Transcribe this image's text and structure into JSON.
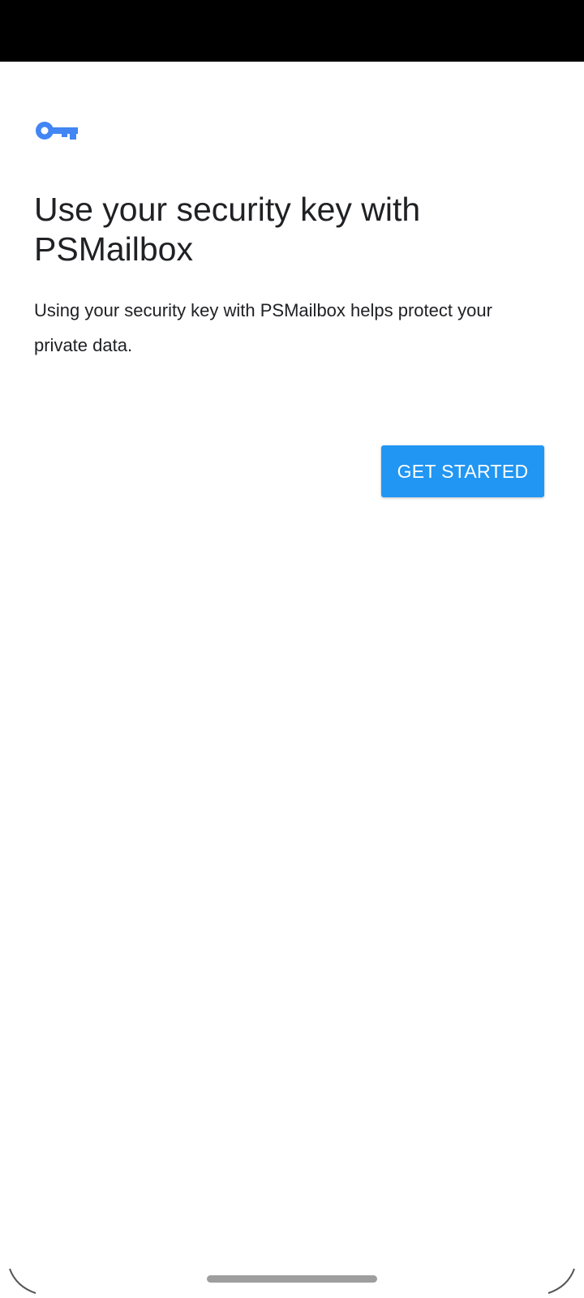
{
  "colors": {
    "accent": "#4285f4",
    "button": "#2196f3",
    "status_bar": "#000000",
    "text": "#202124"
  },
  "icon": "key-icon",
  "title": "Use your security key with PSMailbox",
  "description": "Using your security key with PSMailbox helps protect your private data.",
  "primary_button": {
    "label": "GET STARTED"
  }
}
